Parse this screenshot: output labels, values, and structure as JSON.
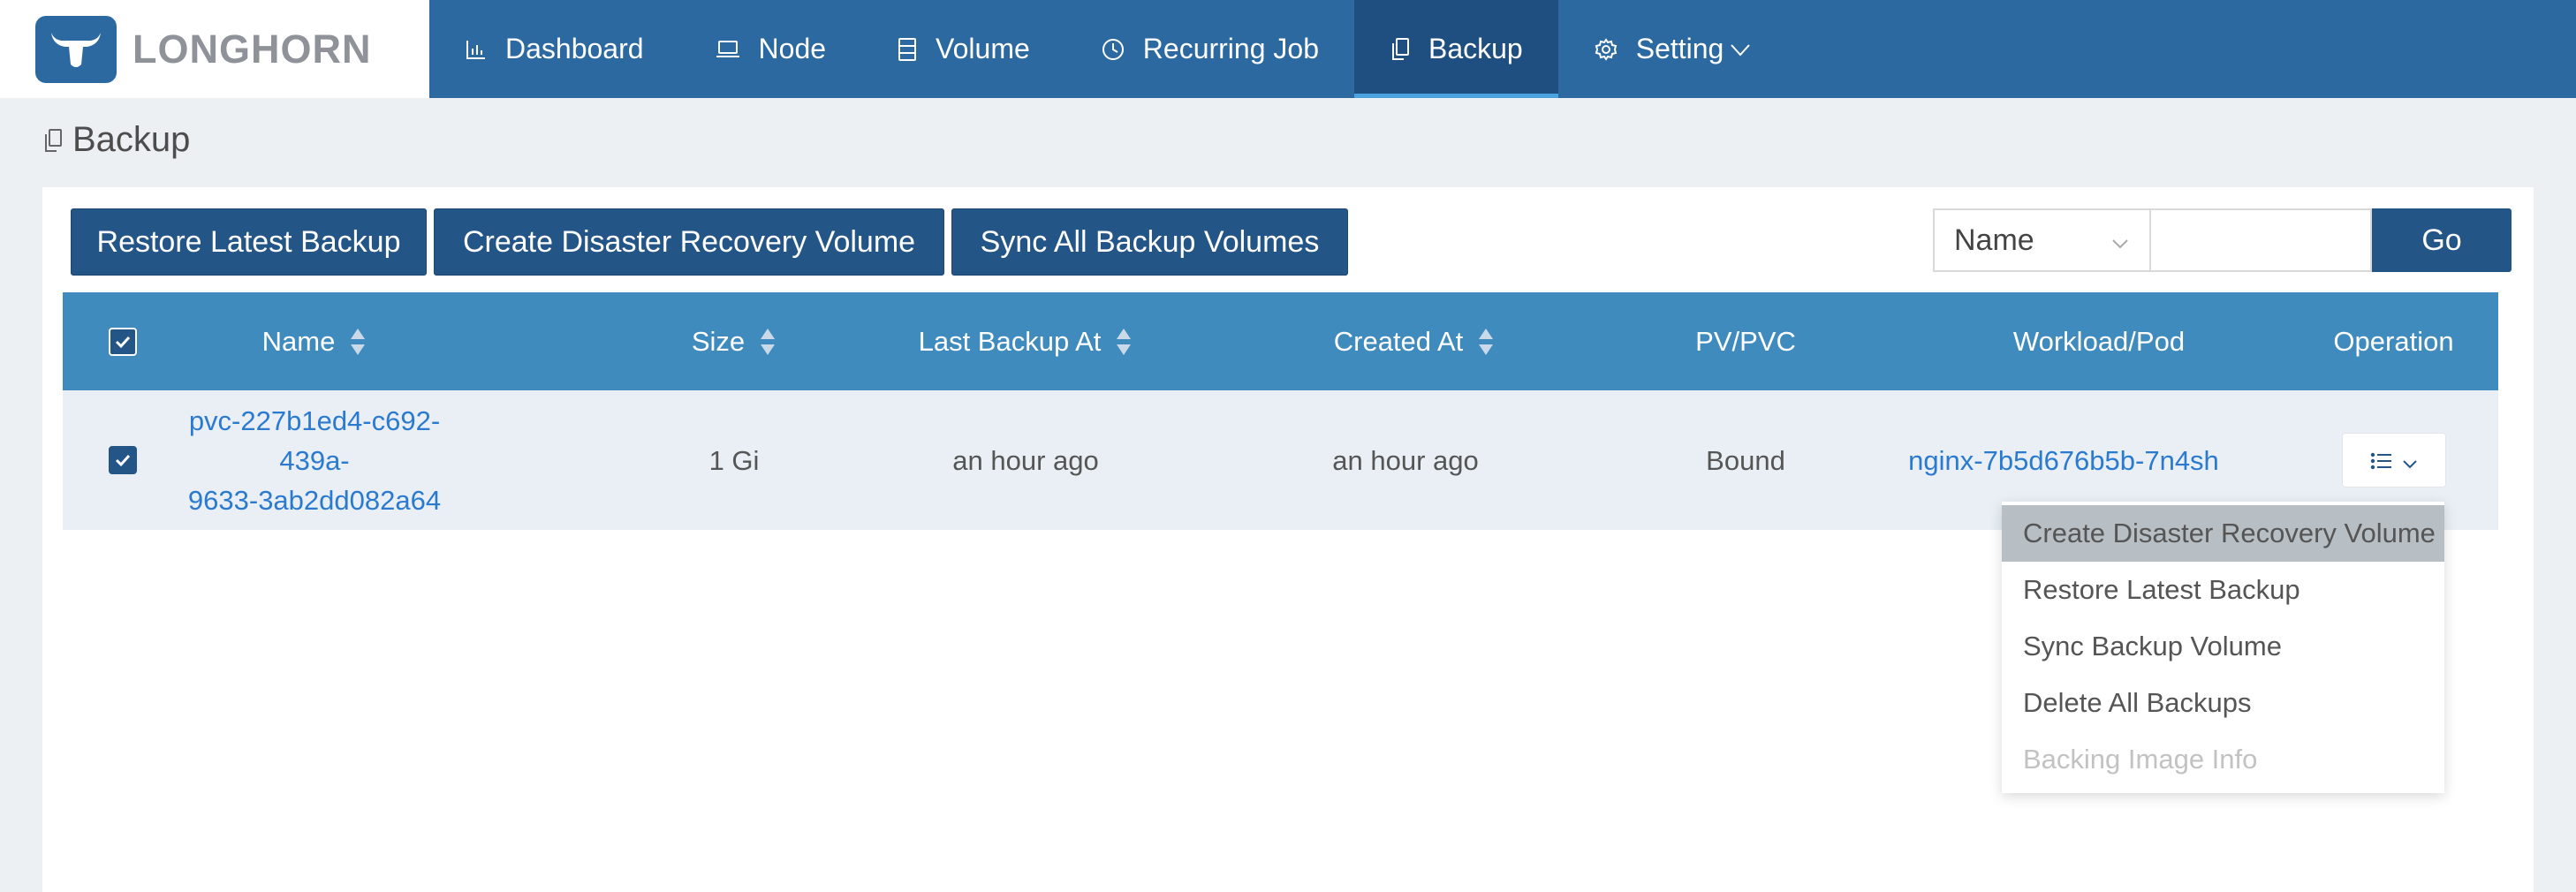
{
  "brand": {
    "name": "LONGHORN"
  },
  "nav": {
    "items": [
      {
        "label": "Dashboard",
        "icon": "bar-chart-icon"
      },
      {
        "label": "Node",
        "icon": "laptop-icon"
      },
      {
        "label": "Volume",
        "icon": "database-icon"
      },
      {
        "label": "Recurring Job",
        "icon": "clock-icon"
      },
      {
        "label": "Backup",
        "icon": "copy-icon",
        "active": true
      },
      {
        "label": "Setting",
        "icon": "gear-icon"
      }
    ]
  },
  "page": {
    "title": "Backup"
  },
  "toolbar": {
    "restore_label": "Restore Latest Backup",
    "create_dr_label": "Create Disaster Recovery Volume",
    "sync_label": "Sync All Backup Volumes",
    "search_field": "Name",
    "search_value": "",
    "go_label": "Go"
  },
  "table": {
    "columns": {
      "name": "Name",
      "size": "Size",
      "last_backup_at": "Last Backup At",
      "created_at": "Created At",
      "pv_pvc": "PV/PVC",
      "workload_pod": "Workload/Pod",
      "operation": "Operation"
    },
    "rows": [
      {
        "name_line1": "pvc-227b1ed4-c692-439a-",
        "name_line2": "9633-3ab2dd082a64",
        "size": "1 Gi",
        "last_backup_at": "an hour ago",
        "created_at": "an hour ago",
        "pv_pvc": "Bound",
        "workload_pod": "nginx-7b5d676b5b-7n4sh",
        "checked": true
      }
    ]
  },
  "operation_menu": {
    "items": [
      {
        "label": "Create Disaster Recovery Volume",
        "highlighted": true
      },
      {
        "label": "Restore Latest Backup"
      },
      {
        "label": "Sync Backup Volume"
      },
      {
        "label": "Delete All Backups"
      },
      {
        "label": "Backing Image Info",
        "disabled": true
      }
    ]
  },
  "colors": {
    "nav_bg": "#2c69a0",
    "nav_active": "#1f4f80",
    "button_bg": "#245587",
    "table_header": "#3f8bbe",
    "link": "#2a7ad0"
  }
}
